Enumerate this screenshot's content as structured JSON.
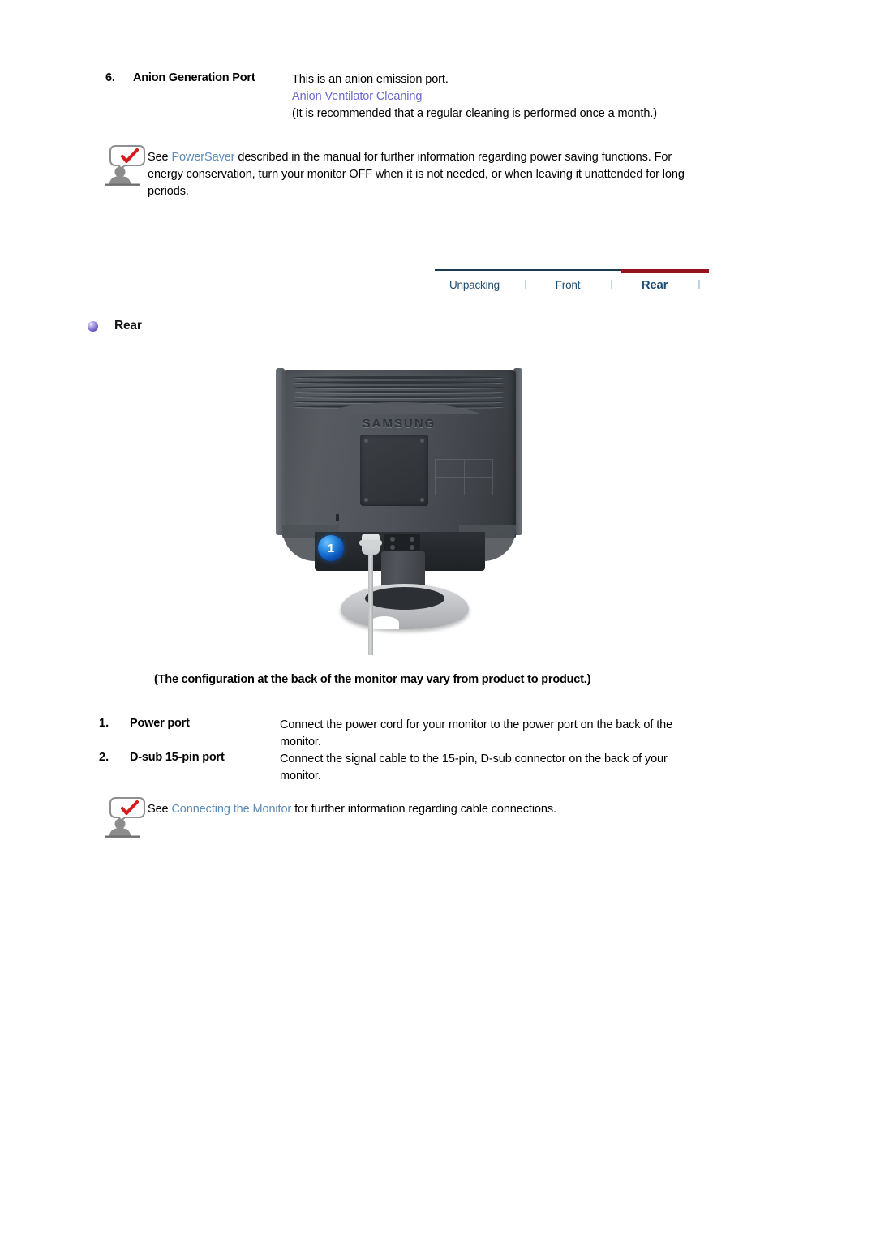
{
  "anion_item": {
    "number": "6.",
    "label": "Anion Generation Port",
    "line1": "This is an anion emission port.",
    "link": "Anion Ventilator Cleaning",
    "line2": "(It is recommended that a regular cleaning is performed once a month.)"
  },
  "note_power": {
    "icon": "note-person-icon",
    "pre": "See ",
    "link": "PowerSaver",
    "post": " described in the manual for further information regarding power saving functions. For energy conservation, turn your monitor OFF when it is not needed, or when leaving it unattended for long periods."
  },
  "tabs": [
    {
      "label": "Unpacking",
      "active": false
    },
    {
      "label": "Front",
      "active": false
    },
    {
      "label": "Rear",
      "active": true
    }
  ],
  "section": {
    "bullet": "sphere-bullet-icon",
    "title": "Rear"
  },
  "figure": {
    "brand_logo": "SAMSUNG",
    "callout_badge": "1",
    "alt": "rear view of monitor"
  },
  "caption": "(The configuration at the back of the monitor may vary from product to product.)",
  "ports": [
    {
      "number": "1.",
      "name": "Power port",
      "description": "Connect the power cord for your monitor to the power port on the back of the monitor."
    },
    {
      "number": "2.",
      "name": "D-sub 15-pin port",
      "description": "Connect the signal cable to the 15-pin, D-sub connector on the back of your monitor."
    }
  ],
  "note_connect": {
    "icon": "note-person-icon",
    "pre": "See ",
    "link": "Connecting the Monitor",
    "post": " for further information regarding cable connections."
  },
  "colors": {
    "link_purple": "#6a6acd",
    "link_blue": "#5a8ab8",
    "tab_text": "#1f4d72",
    "tab_active_bar": "#96121c",
    "tab_bar": "#1b3a52",
    "badge_blue": "#0b52b8"
  }
}
